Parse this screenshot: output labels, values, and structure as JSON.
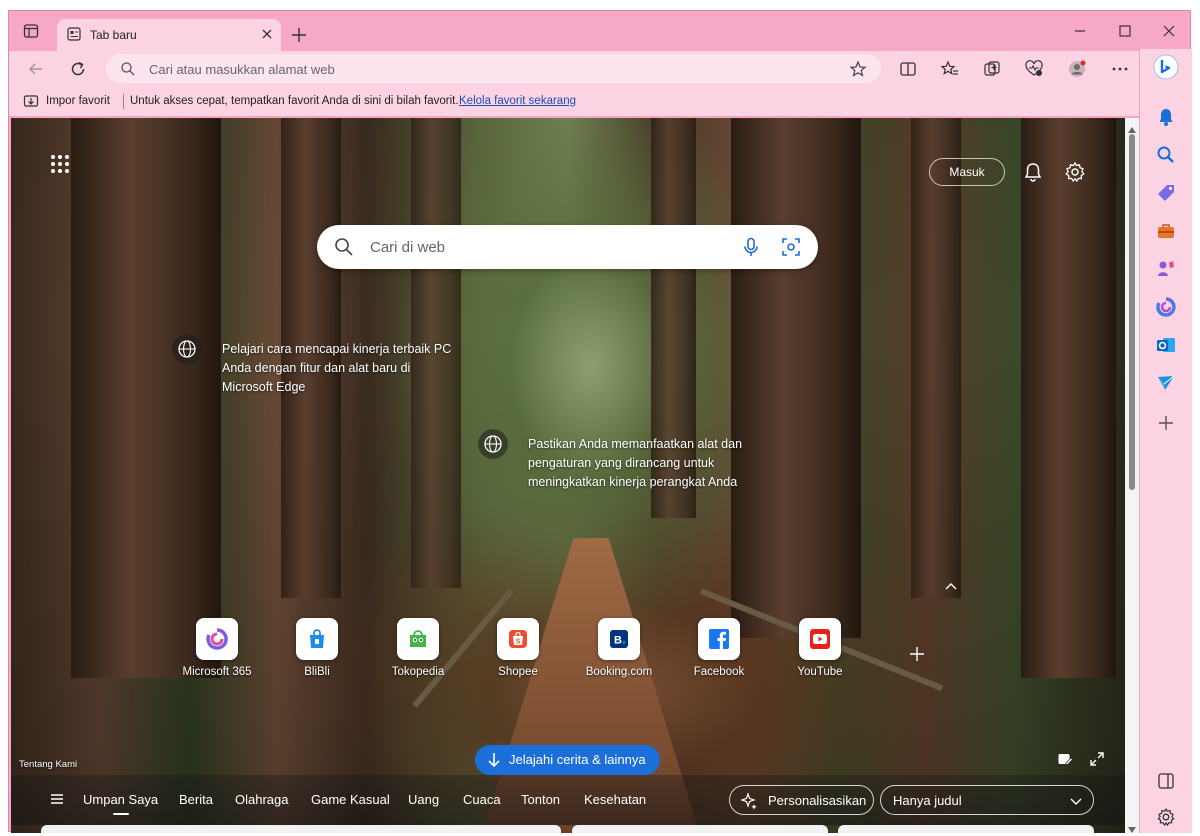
{
  "tab": {
    "title": "Tab baru"
  },
  "address_bar": {
    "placeholder": "Cari atau masukkan alamat web"
  },
  "favorites_bar": {
    "import_label": "Impor favorit",
    "hint": "Untuk akses cepat, tempatkan favorit Anda di sini di bilah favorit.",
    "manage_link": "Kelola favorit sekarang"
  },
  "header": {
    "signin_label": "Masuk"
  },
  "search": {
    "placeholder": "Cari di web"
  },
  "tips": [
    {
      "text": "Pelajari cara mencapai kinerja terbaik PC Anda dengan fitur dan alat baru di Microsoft Edge"
    },
    {
      "text": "Pastikan Anda memanfaatkan alat dan pengaturan yang dirancang untuk meningkatkan kinerja perangkat Anda"
    }
  ],
  "quick_links": [
    {
      "label": "Microsoft 365",
      "icon": "microsoft-365-icon",
      "color": "#7b5ce6"
    },
    {
      "label": "BliBli",
      "icon": "blibli-icon",
      "color": "#1d8ee8"
    },
    {
      "label": "Tokopedia",
      "icon": "tokopedia-icon",
      "color": "#42b549"
    },
    {
      "label": "Shopee",
      "icon": "shopee-icon",
      "color": "#ee4d2d"
    },
    {
      "label": "Booking.com",
      "icon": "booking-icon",
      "color": "#003580"
    },
    {
      "label": "Facebook",
      "icon": "facebook-icon",
      "color": "#1877f2"
    },
    {
      "label": "YouTube",
      "icon": "youtube-icon",
      "color": "#e62117"
    }
  ],
  "footer": {
    "about": "Tentang Kami",
    "explore_label": "Jelajahi cerita & lainnya"
  },
  "feed_nav": {
    "items": [
      "Umpan Saya",
      "Berita",
      "Olahraga",
      "Game Kasual",
      "Uang",
      "Cuaca",
      "Tonton",
      "Kesehatan"
    ],
    "personalize_label": "Personalisasikan",
    "layout_value": "Hanya judul"
  },
  "colors": {
    "frame": "#f7a8c6",
    "toolbar": "#fbd3e2",
    "accent_button": "#1c6ed8",
    "link": "#1a4fb5"
  }
}
